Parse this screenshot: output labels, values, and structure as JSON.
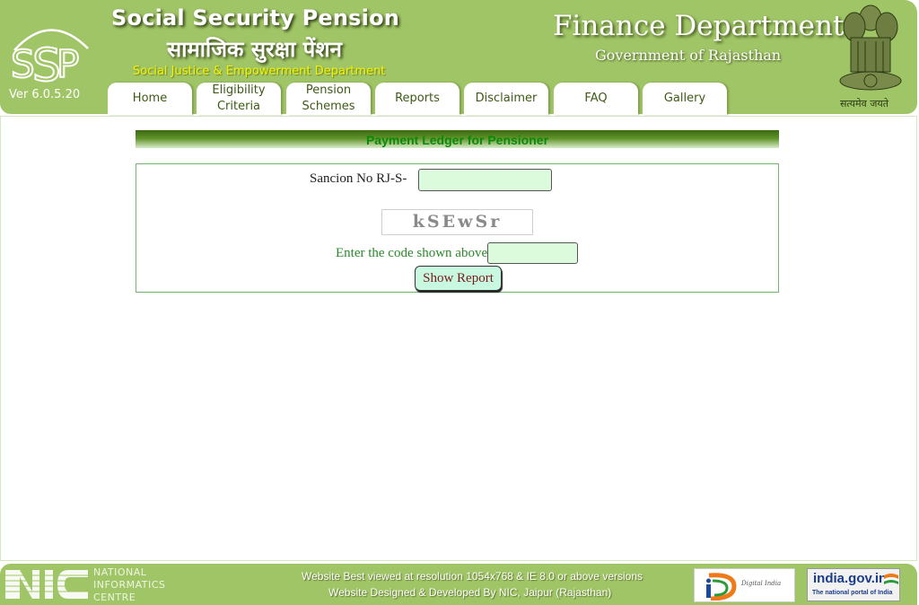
{
  "header": {
    "version": "Ver 6.0.5.20",
    "title_en": "Social Security Pension",
    "title_hi": "सामाजिक सुरक्षा पेंशन",
    "department": "Social Justice & Empowerment Department",
    "finance_title": "Finance Department",
    "finance_subtitle": "Government of Rajasthan",
    "motto": "सत्यमेव जयते",
    "logo_text": "SSP"
  },
  "nav": {
    "tabs": [
      {
        "label": "Home"
      },
      {
        "label": "Eligibility\nCriteria"
      },
      {
        "label": "Pension\nSchemes"
      },
      {
        "label": "Reports"
      },
      {
        "label": "Disclaimer"
      },
      {
        "label": "FAQ"
      },
      {
        "label": "Gallery"
      }
    ]
  },
  "main": {
    "section_title": "Payment Ledger for Pensioner",
    "sanction_label": "Sancion No RJ-S-",
    "sanction_value": "",
    "captcha_text": "kSEwSr",
    "code_label": "Enter the code shown above:",
    "code_value": "",
    "show_report_label": "Show Report"
  },
  "footer": {
    "nic_line1": "NATIONAL",
    "nic_line2": "INFORMATICS",
    "nic_line3": "CENTRE",
    "line1": "Website Best viewed at resolution 1054x768 & IE 8.0 or above versions",
    "line2": "Website Designed & Developed By NIC, Jaipur (Rajasthan)",
    "digital_india": "Digital India",
    "india_gov_title": "india.gov.in",
    "india_gov_sub": "The national portal of India"
  },
  "colors": {
    "brand_green": "#a0c566",
    "input_bg": "#dcfadc",
    "button_bg": "#c8f8e0",
    "title_green": "#0a8a0a"
  }
}
